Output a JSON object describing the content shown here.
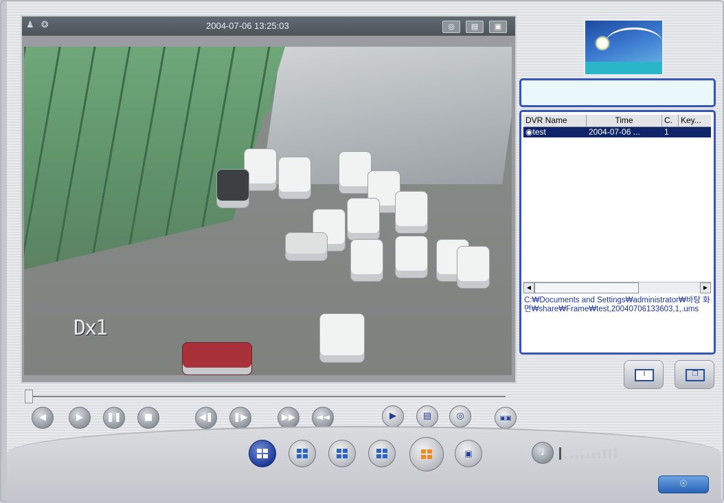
{
  "video": {
    "timestamp": "2004-07-06 13:25:03",
    "osd_label": "Dx1",
    "status_icons": [
      "person-icon",
      "sun-icon"
    ],
    "header_buttons": [
      "camera-icon",
      "print-icon",
      "snapshot-icon"
    ]
  },
  "playback": {
    "buttons": [
      "rewind-icon",
      "play-icon",
      "pause-icon",
      "stop-icon",
      "step-back-icon",
      "step-forward-icon",
      "fast-forward-icon",
      "fast-rewind-icon",
      "export-icon",
      "print-icon",
      "snapshot-icon",
      "multiview-icon"
    ]
  },
  "layout_buttons": {
    "items": [
      "layout-1-icon",
      "layout-4-icon",
      "layout-9-icon",
      "layout-16-icon",
      "layout-split-icon",
      "camera-switch-icon"
    ]
  },
  "list": {
    "columns": [
      "DVR Name",
      "Time",
      "C.",
      "Key..."
    ],
    "rows": [
      {
        "name": "test",
        "time": "2004-07-06 ...",
        "channel": "1",
        "key": ""
      }
    ],
    "path": "C:₩Documents and Settings₩administrator₩바탕 화면₩share₩Frame₩test,20040706133603,1,.ums"
  },
  "volume": {
    "level": 0.0
  },
  "colors": {
    "accent_blue": "#3555b7",
    "selection": "#10246a",
    "info_button": "#2a63b5"
  }
}
